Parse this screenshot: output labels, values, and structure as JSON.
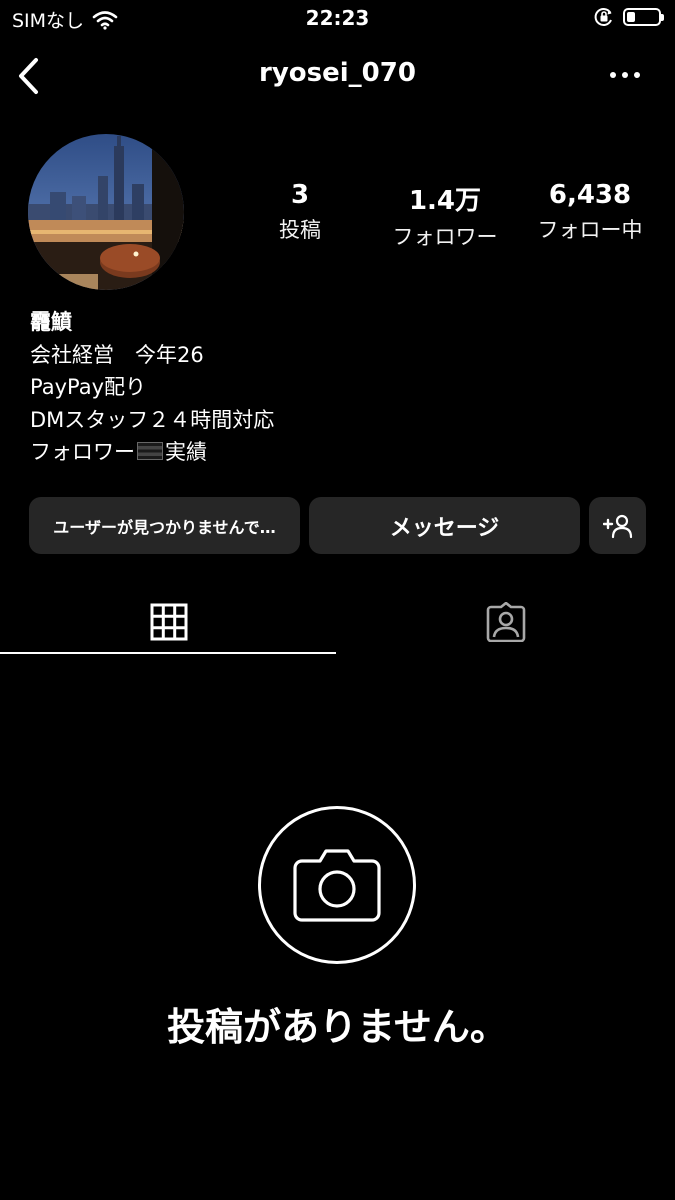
{
  "status_bar": {
    "carrier": "SIMなし",
    "time": "22:23",
    "battery_level": 0.25
  },
  "nav": {
    "username": "ryosei_070",
    "back_icon": "chevron-left-icon",
    "more_icon": "more-horizontal-icon"
  },
  "profile": {
    "stats": [
      {
        "value": "3",
        "label": "投稿"
      },
      {
        "value": "1.4万",
        "label": "フォロワー"
      },
      {
        "value": "6,438",
        "label": "フォロー中"
      }
    ],
    "bio": {
      "name": "龗鱝",
      "lines": [
        "会社経営　今年26",
        "PayPay配り",
        "DMスタッフ２４時間対応"
      ],
      "last_line_prefix": "フォロワー",
      "last_line_suffix": "実績"
    }
  },
  "buttons": {
    "status_label": "ユーザーが見つかりませんで…",
    "message_label": "メッセージ",
    "add_icon": "person-add-icon"
  },
  "tabs": [
    {
      "icon": "grid-icon",
      "active": true
    },
    {
      "icon": "tagged-person-icon",
      "active": false
    }
  ],
  "empty_state": {
    "icon": "camera-icon",
    "text": "投稿がありません。"
  }
}
